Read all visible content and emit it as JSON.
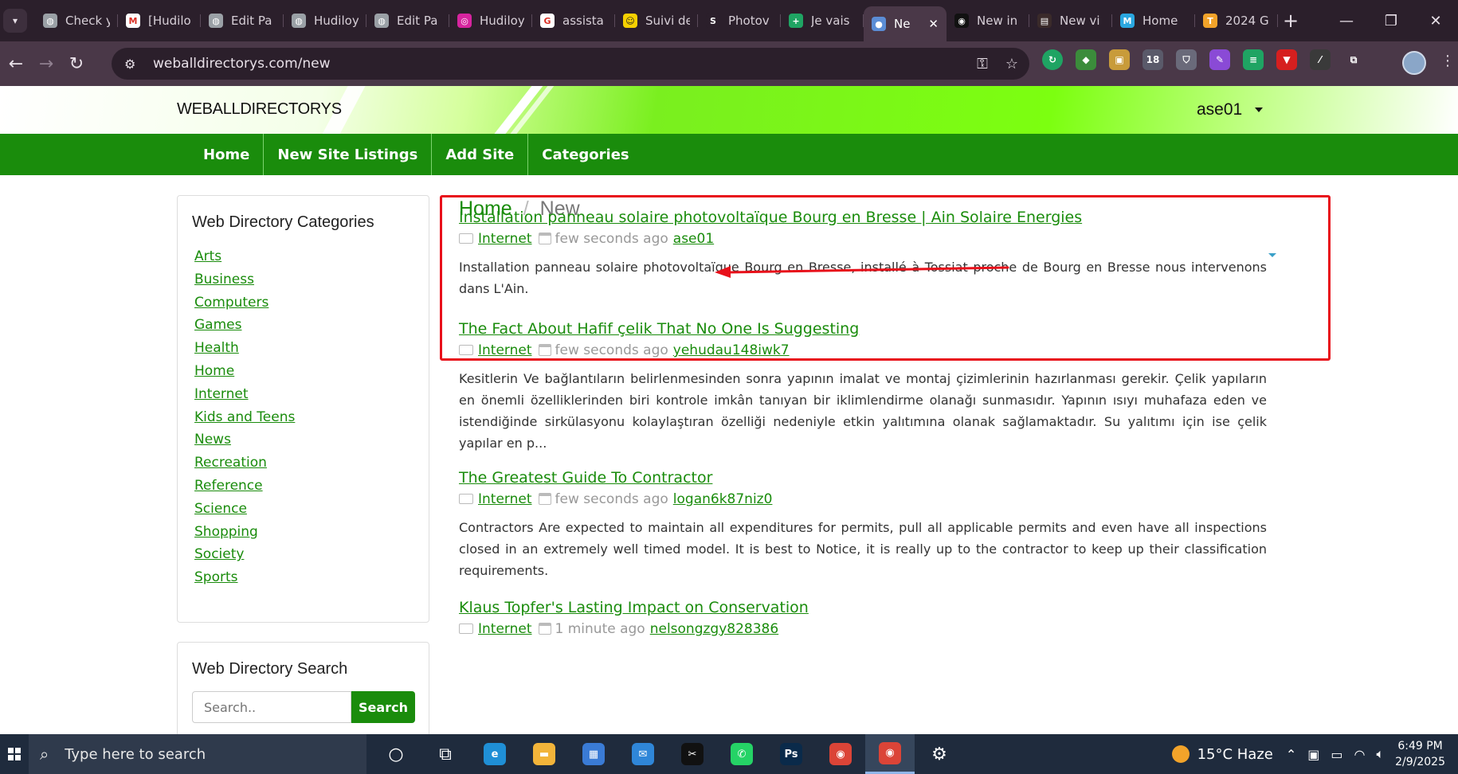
{
  "browser": {
    "tabs": [
      {
        "title": "Check y",
        "fav_color": "#9aa0a6",
        "fav_glyph": "◍"
      },
      {
        "title": "[Hudilo",
        "fav_color": "#ffffff",
        "fav_glyph": "M"
      },
      {
        "title": "Edit Pa",
        "fav_color": "#9aa0a6",
        "fav_glyph": "◍"
      },
      {
        "title": "Hudiloy",
        "fav_color": "#9aa0a6",
        "fav_glyph": "◍"
      },
      {
        "title": "Edit Pa",
        "fav_color": "#9aa0a6",
        "fav_glyph": "◍"
      },
      {
        "title": "Hudiloy",
        "fav_color": "#d6249f",
        "fav_glyph": "◎"
      },
      {
        "title": "assista",
        "fav_color": "#ffffff",
        "fav_glyph": "G"
      },
      {
        "title": "Suivi de",
        "fav_color": "#f5d000",
        "fav_glyph": "☺"
      },
      {
        "title": "Photov",
        "fav_color": "#2b1f2b",
        "fav_glyph": "S"
      },
      {
        "title": "Je vais",
        "fav_color": "#1fa463",
        "fav_glyph": "+"
      },
      {
        "title": "Ne",
        "fav_color": "#5b8dd6",
        "fav_glyph": "●",
        "active": true
      },
      {
        "title": "New in",
        "fav_color": "#111111",
        "fav_glyph": "◉"
      },
      {
        "title": "New vi",
        "fav_color": "#3a2a2a",
        "fav_glyph": "▤"
      },
      {
        "title": "Home",
        "fav_color": "#2aa7e0",
        "fav_glyph": "M"
      },
      {
        "title": "2024 G",
        "fav_color": "#f2a32a",
        "fav_glyph": "T"
      }
    ],
    "close_glyph": "✕",
    "new_tab_glyph": "+",
    "url": "weballdirectorys.com/new",
    "window_controls": [
      "—",
      "❐",
      "✕"
    ]
  },
  "site": {
    "brand": "WEBALLDIRECTORYS",
    "user": "ase01",
    "nav": [
      "Home",
      "New Site Listings",
      "Add Site",
      "Categories"
    ]
  },
  "sidebar": {
    "categories_title": "Web Directory Categories",
    "categories": [
      "Arts",
      "Business",
      "Computers",
      "Games",
      "Health",
      "Home",
      "Internet",
      "Kids and Teens",
      "News",
      "Recreation",
      "Reference",
      "Science",
      "Shopping",
      "Society",
      "Sports"
    ],
    "search_title": "Web Directory Search",
    "search_placeholder": "Search..",
    "search_button": "Search"
  },
  "breadcrumb": {
    "home": "Home",
    "separator": "/",
    "current": "New"
  },
  "listings": [
    {
      "title": "Installation panneau solaire photovoltaïque Bourg en Bresse | Ain Solaire Energies",
      "category": "Internet",
      "time": "few seconds ago",
      "user": "ase01",
      "description": "Installation panneau solaire photovoltaïque Bourg en Bresse, installé à Tossiat proche de Bourg en Bresse nous intervenons dans L'Ain."
    },
    {
      "title": "The Fact About Hafif çelik That No One Is Suggesting",
      "category": "Internet",
      "time": "few seconds ago",
      "user": "yehudau148iwk7",
      "description": "Kesitlerin Ve bağlantıların belirlenmesinden sonra yapının imalat ve montaj çizimlerinin hazırlanması gerekir. Çelik yapıların en önemli özelliklerinden biri kontrole imkân tanıyan bir iklimlendirme olanağı sunmasıdır. Yapının ısıyı muhafaza eden ve istendiğinde sirkülasyonu kolaylaştıran özelliği nedeniyle etkin yalıtımına olanak sağlamaktadır. Su yalıtımı için ise çelik yapılar en p..."
    },
    {
      "title": "The Greatest Guide To Contractor",
      "category": "Internet",
      "time": "few seconds ago",
      "user": "logan6k87niz0",
      "description": "Contractors Are expected to maintain all expenditures for permits, pull all applicable permits and even have all inspections closed in an extremely well timed model. It is best to Notice, it is really up to the contractor to keep up their classification requirements."
    },
    {
      "title": "Klaus Topfer's Lasting Impact on Conservation",
      "category": "Internet",
      "time": "1 minute ago",
      "user": "nelsongzgy828386",
      "description": ""
    }
  ],
  "annotation": {
    "color": "#e8101a"
  },
  "taskbar": {
    "search_placeholder": "Type here to search",
    "apps": [
      {
        "name": "cortana-icon",
        "glyph": "○",
        "bg": ""
      },
      {
        "name": "task-view-icon",
        "glyph": "⧉",
        "bg": ""
      },
      {
        "name": "edge-icon",
        "glyph": "e",
        "bg": "#1f8fd6"
      },
      {
        "name": "file-explorer-icon",
        "glyph": "▬",
        "bg": "#f2b43a"
      },
      {
        "name": "store-icon",
        "glyph": "▦",
        "bg": "#3a7bd5"
      },
      {
        "name": "mail-icon",
        "glyph": "✉",
        "bg": "#2f86d8"
      },
      {
        "name": "capcut-icon",
        "glyph": "✂",
        "bg": "#111111"
      },
      {
        "name": "whatsapp-icon",
        "glyph": "✆",
        "bg": "#25d366"
      },
      {
        "name": "photoshop-icon",
        "glyph": "Ps",
        "bg": "#0a2a4a"
      },
      {
        "name": "chrome-icon",
        "glyph": "◉",
        "bg": "#db4437"
      },
      {
        "name": "chrome-profile-icon",
        "glyph": "◉",
        "bg": "#db4437",
        "active": true
      },
      {
        "name": "settings-icon",
        "glyph": "⚙",
        "bg": ""
      }
    ],
    "weather": "15°C  Haze",
    "time": "6:49 PM",
    "date": "2/9/2025"
  }
}
